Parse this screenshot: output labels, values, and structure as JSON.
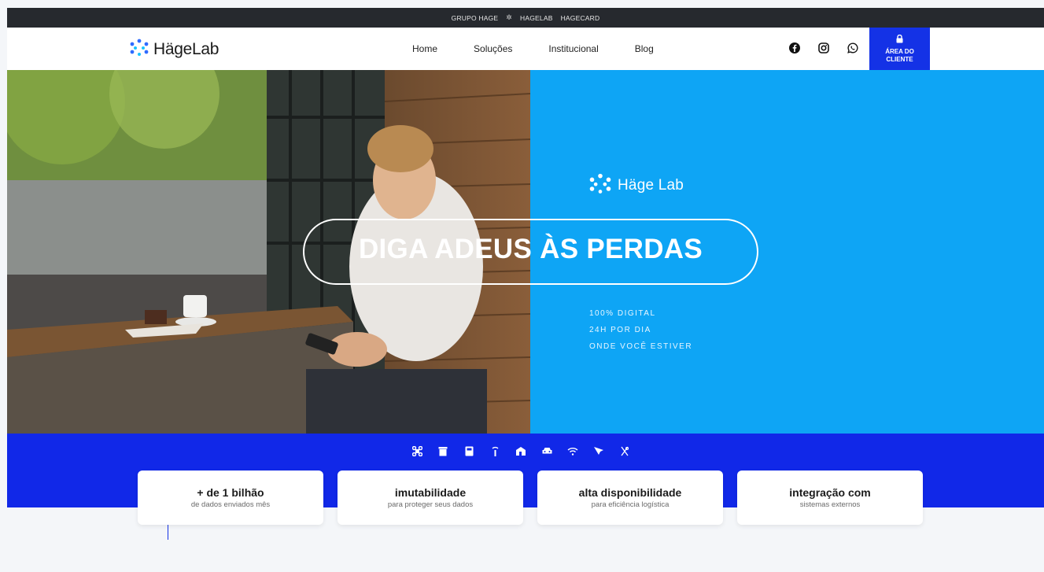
{
  "topbar": {
    "left": "GRUPO HAGE",
    "separator": "✲",
    "middle": "HAGELAB",
    "right": "HAGECARD"
  },
  "header": {
    "logo_text": "HägeLab",
    "nav": [
      {
        "label": "Home"
      },
      {
        "label": "Soluções"
      },
      {
        "label": "Institucional"
      },
      {
        "label": "Blog"
      }
    ],
    "social_icons": [
      "facebook-icon",
      "instagram-icon",
      "whatsapp-icon"
    ],
    "client_area": {
      "line1": "ÁREA DO",
      "line2": "CLIENTE",
      "icon": "lock-icon"
    }
  },
  "hero": {
    "logo_text": "Häge Lab",
    "headline": "DIGA ADEUS ÀS PERDAS",
    "taglines": [
      "100% DIGITAL",
      "24H POR DIA",
      "ONDE VOCÊ ESTIVER"
    ],
    "accent_color": "#0ea5f5"
  },
  "band": {
    "color": "#1128e8",
    "icons": [
      "drone-icon",
      "bin-icon",
      "meter-icon",
      "antenna-icon",
      "building-icon",
      "car-icon",
      "wifi-icon",
      "satellite-icon",
      "tool-icon"
    ]
  },
  "features": [
    {
      "title": "+ de 1 bilhão",
      "subtitle": "de dados enviados mês"
    },
    {
      "title": "imutabilidade",
      "subtitle": "para proteger seus dados"
    },
    {
      "title": "alta disponibilidade",
      "subtitle": "para eficiência logística"
    },
    {
      "title": "integração com",
      "subtitle": "sistemas externos"
    }
  ]
}
